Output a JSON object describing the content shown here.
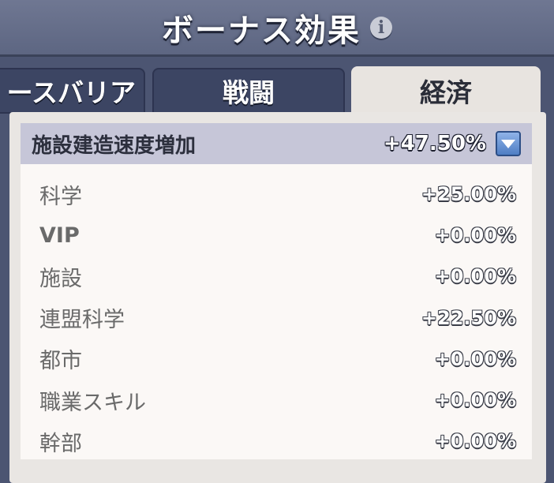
{
  "header": {
    "title": "ボーナス効果"
  },
  "tabs": [
    {
      "label": "ースバリア",
      "active": false
    },
    {
      "label": "戦闘",
      "active": false
    },
    {
      "label": "経済",
      "active": true
    }
  ],
  "summary": {
    "label": "施設建造速度増加",
    "value": "+47.50%"
  },
  "items": [
    {
      "label": "科学",
      "value": "+25.00%"
    },
    {
      "label": "VIP",
      "value": "+0.00%"
    },
    {
      "label": "施設",
      "value": "+0.00%"
    },
    {
      "label": "連盟科学",
      "value": "+22.50%"
    },
    {
      "label": "都市",
      "value": "+0.00%"
    },
    {
      "label": "職業スキル",
      "value": "+0.00%"
    },
    {
      "label": "幹部",
      "value": "+0.00%"
    }
  ],
  "colors": {
    "accent": "#5a88cc",
    "header_bg": "#6f7792",
    "panel_bg": "#e9e6e3"
  },
  "icons": {
    "info": "info-icon",
    "dropdown": "chevron-down-icon"
  }
}
